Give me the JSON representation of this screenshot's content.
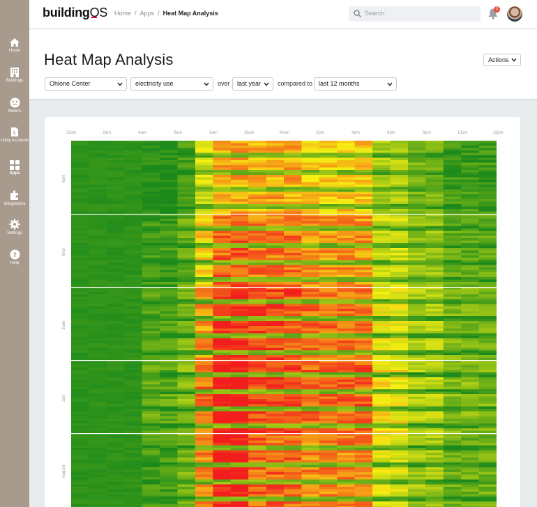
{
  "app": {
    "logo_bold": "building",
    "logo_light": "OS"
  },
  "sidebar": {
    "items": [
      {
        "label": "Home",
        "icon": "home-icon"
      },
      {
        "label": "Buildings",
        "icon": "building-icon"
      },
      {
        "label": "Meters",
        "icon": "meter-icon"
      },
      {
        "label": "Utility Accounts",
        "icon": "bill-icon"
      },
      {
        "label": "Apps",
        "icon": "apps-grid-icon",
        "active": true
      },
      {
        "label": "Integrations",
        "icon": "puzzle-icon"
      },
      {
        "label": "Settings",
        "icon": "gear-icon"
      },
      {
        "label": "Help",
        "icon": "help-icon"
      }
    ]
  },
  "breadcrumb": {
    "home": "Home",
    "apps": "Apps",
    "current": "Heat Map Analysis"
  },
  "search": {
    "placeholder": "Search"
  },
  "notifications": {
    "count": "2"
  },
  "page": {
    "title": "Heat Map Analysis",
    "actions_label": "Actions"
  },
  "filters": {
    "location": "Ohlone Center",
    "metric": "electricity use",
    "over_text": "over",
    "period": "last year",
    "compared_text": "compared to",
    "comparison": "last 12 months"
  },
  "chart_data": {
    "type": "heatmap",
    "x_ticks": [
      "12am",
      "2am",
      "4am",
      "6am",
      "8am",
      "10am",
      "Noon",
      "2pm",
      "4pm",
      "6pm",
      "8pm",
      "10pm",
      "12pm"
    ],
    "y_labels": [
      "April",
      "May",
      "June",
      "July",
      "August"
    ],
    "columns": 24,
    "color_scale": [
      "#1b8a1b",
      "#f7ef12",
      "#f21d1d"
    ]
  }
}
